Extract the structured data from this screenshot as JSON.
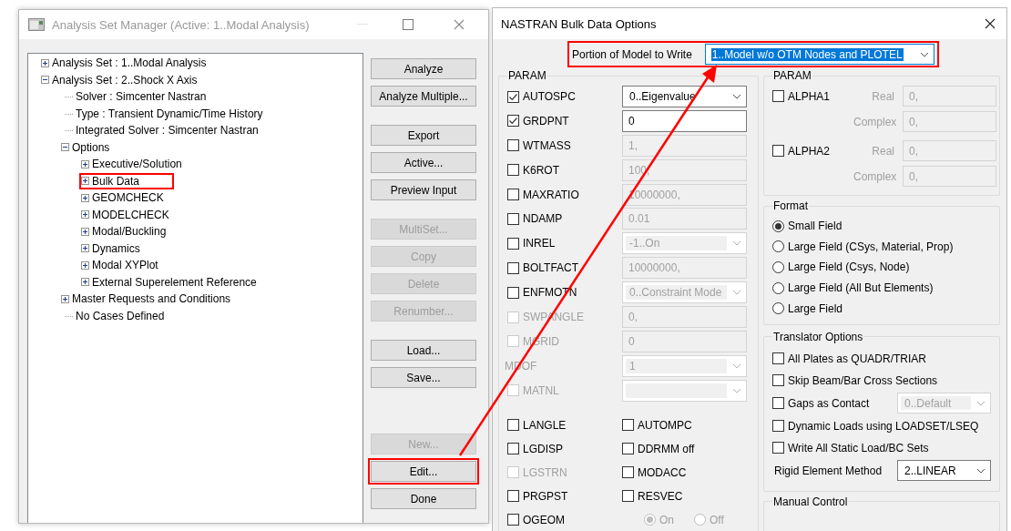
{
  "analysis_window": {
    "title": "Analysis Set Manager (Active: 1..Modal Analysis)",
    "tree": [
      {
        "label": "Analysis Set : 1..Modal Analysis",
        "expanded": false,
        "highlighted": false
      },
      {
        "label": "Analysis Set : 2..Shock X Axis",
        "expanded": true,
        "highlighted": false,
        "children": [
          {
            "label": "Solver : Simcenter Nastran",
            "highlighted": false
          },
          {
            "label": "Type : Transient Dynamic/Time History",
            "highlighted": false
          },
          {
            "label": "Integrated Solver : Simcenter Nastran",
            "highlighted": false
          },
          {
            "label": "Options",
            "expanded": true,
            "highlighted": false,
            "children": [
              {
                "label": "Executive/Solution",
                "expanded": false,
                "highlighted": false
              },
              {
                "label": "Bulk Data",
                "expanded": false,
                "highlighted": true
              },
              {
                "label": "GEOMCHECK",
                "expanded": false,
                "highlighted": false
              },
              {
                "label": "MODELCHECK",
                "expanded": false,
                "highlighted": false
              },
              {
                "label": "Modal/Buckling",
                "expanded": false,
                "highlighted": false
              },
              {
                "label": "Dynamics",
                "expanded": false,
                "highlighted": false
              },
              {
                "label": "Modal XYPlot",
                "expanded": false,
                "highlighted": false
              },
              {
                "label": "External Superelement Reference",
                "expanded": false,
                "highlighted": false
              }
            ]
          },
          {
            "label": "Master Requests and Conditions",
            "expanded": false,
            "highlighted": false
          },
          {
            "label": "No Cases Defined",
            "highlighted": false
          }
        ]
      }
    ],
    "button_groups": [
      [
        {
          "label": "Analyze",
          "disabled": false,
          "highlighted": false
        },
        {
          "label": "Analyze Multiple...",
          "disabled": false,
          "highlighted": false
        }
      ],
      [
        {
          "label": "Export",
          "disabled": false,
          "highlighted": false
        },
        {
          "label": "Active...",
          "disabled": false,
          "highlighted": false
        },
        {
          "label": "Preview Input",
          "disabled": false,
          "highlighted": false
        }
      ],
      [
        {
          "label": "MultiSet...",
          "disabled": true,
          "highlighted": false
        },
        {
          "label": "Copy",
          "disabled": true,
          "highlighted": false
        },
        {
          "label": "Delete",
          "disabled": true,
          "highlighted": false
        },
        {
          "label": "Renumber...",
          "disabled": true,
          "highlighted": false
        }
      ],
      [
        {
          "label": "Load...",
          "disabled": false,
          "highlighted": false
        },
        {
          "label": "Save...",
          "disabled": false,
          "highlighted": false
        }
      ],
      [
        {
          "label": "New...",
          "disabled": true,
          "highlighted": false
        },
        {
          "label": "Edit...",
          "disabled": false,
          "highlighted": true
        },
        {
          "label": "Done",
          "disabled": false,
          "highlighted": false
        }
      ]
    ]
  },
  "bulk_dialog": {
    "title": "NASTRAN Bulk Data Options",
    "portion": {
      "label": "Portion of Model to Write",
      "value": "1..Model w/o OTM Nodes and PLOTEL",
      "text_selected": true,
      "highlighted": true
    },
    "param": {
      "title": "PARAM",
      "rows": [
        {
          "kind": "check_combo",
          "label": "AUTOSPC",
          "checked": true,
          "disabled": false,
          "value": "0..Eigenvalue",
          "field_disabled": false
        },
        {
          "kind": "check_input",
          "label": "GRDPNT",
          "checked": true,
          "disabled": false,
          "value": "0",
          "field_disabled": false
        },
        {
          "kind": "check_input",
          "label": "WTMASS",
          "checked": false,
          "disabled": false,
          "value": "1,",
          "field_disabled": true
        },
        {
          "kind": "check_input",
          "label": "K6ROT",
          "checked": false,
          "disabled": false,
          "value": "100,",
          "field_disabled": true
        },
        {
          "kind": "check_input",
          "label": "MAXRATIO",
          "checked": false,
          "disabled": false,
          "value": "10000000,",
          "field_disabled": true
        },
        {
          "kind": "check_input",
          "label": "NDAMP",
          "checked": false,
          "disabled": false,
          "value": "0.01",
          "field_disabled": true
        },
        {
          "kind": "check_combo",
          "label": "INREL",
          "checked": false,
          "disabled": false,
          "value": "-1..On",
          "field_disabled": true
        },
        {
          "kind": "check_input",
          "label": "BOLTFACT",
          "checked": false,
          "disabled": false,
          "value": "10000000,",
          "field_disabled": true
        },
        {
          "kind": "check_combo",
          "label": "ENFMOTN",
          "checked": false,
          "disabled": false,
          "value": "0..Constraint Mode",
          "field_disabled": true
        },
        {
          "kind": "check_input",
          "label": "SWPANGLE",
          "checked": false,
          "disabled": true,
          "value": "0,",
          "field_disabled": true
        },
        {
          "kind": "check_input",
          "label": "MGRID",
          "checked": false,
          "disabled": true,
          "value": "0",
          "field_disabled": true
        },
        {
          "kind": "combo",
          "label": "MDOF",
          "disabled": true,
          "value": "1",
          "field_disabled": true
        },
        {
          "kind": "check_combo",
          "label": "MATNL",
          "checked": false,
          "disabled": true,
          "field_disabled": true
        }
      ],
      "flags": [
        {
          "label": "LANGLE",
          "checked": false,
          "disabled": false
        },
        {
          "label": "AUTOMPC",
          "checked": false,
          "disabled": false
        },
        {
          "label": "LGDISP",
          "checked": false,
          "disabled": false
        },
        {
          "label": "DDRMM off",
          "checked": false,
          "disabled": false
        },
        {
          "label": "LGSTRN",
          "checked": false,
          "disabled": true
        },
        {
          "label": "MODACC",
          "checked": false,
          "disabled": false
        },
        {
          "label": "PRGPST",
          "checked": false,
          "disabled": false
        },
        {
          "label": "RESVEC",
          "checked": false,
          "disabled": false
        }
      ],
      "ogeom": {
        "label": "OGEOM",
        "checked": false,
        "disabled": false,
        "options": [
          {
            "label": "On",
            "selected": true,
            "disabled": true
          },
          {
            "label": "Off",
            "selected": false,
            "disabled": true
          }
        ]
      }
    },
    "alpha": {
      "title": "PARAM",
      "items": [
        {
          "label": "ALPHA1",
          "checked": false,
          "fields": [
            {
              "label": "Real",
              "value": "0,",
              "disabled": true
            },
            {
              "label": "Complex",
              "value": "0,",
              "disabled": true
            }
          ]
        },
        {
          "label": "ALPHA2",
          "checked": false,
          "fields": [
            {
              "label": "Real",
              "value": "0,",
              "disabled": true
            },
            {
              "label": "Complex",
              "value": "0,",
              "disabled": true
            }
          ]
        }
      ]
    },
    "format": {
      "title": "Format",
      "options": [
        {
          "label": "Small Field",
          "selected": true
        },
        {
          "label": "Large Field (CSys, Material, Prop)",
          "selected": false
        },
        {
          "label": "Large Field (Csys, Node)",
          "selected": false
        },
        {
          "label": "Large Field (All But Elements)",
          "selected": false
        },
        {
          "label": "Large Field",
          "selected": false
        }
      ]
    },
    "translator": {
      "title": "Translator Options",
      "options": [
        {
          "kind": "check",
          "label": "All Plates as QUADR/TRIAR",
          "checked": false
        },
        {
          "kind": "check",
          "label": "Skip Beam/Bar Cross Sections",
          "checked": false
        },
        {
          "kind": "check_combo",
          "label": "Gaps as Contact",
          "checked": false,
          "value": "0..Default",
          "field_disabled": true
        },
        {
          "kind": "check",
          "label": "Dynamic Loads using LOADSET/LSEQ",
          "checked": false
        },
        {
          "kind": "check",
          "label": "Write All Static Load/BC Sets",
          "checked": false
        }
      ],
      "rigid": {
        "label": "Rigid Element Method",
        "value": "2..LINEAR",
        "field_disabled": false
      }
    },
    "manual": {
      "title": "Manual Control"
    }
  }
}
